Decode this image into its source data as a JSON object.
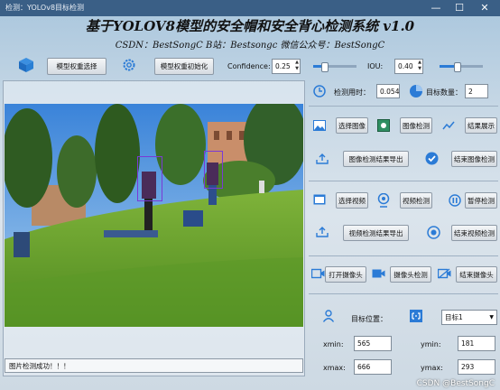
{
  "window": {
    "title": "检测：YOLOv8目标检测",
    "controls": [
      "—",
      "☐",
      "✕"
    ]
  },
  "header": {
    "title": "基于YOLOV8模型的安全帽和安全背心检测系统 v1.0",
    "subtitle": "CSDN：BestSongC   B站：Bestsongc   微信公众号：BestSongC"
  },
  "toolbar": {
    "select_weights_label": "模型权重选择",
    "init_weights_label": "模型权重初始化",
    "confidence_label": "Confidence:",
    "confidence_value": "0.25",
    "confidence_level": 0.25,
    "iou_label": "IOU:",
    "iou_value": "0.40",
    "iou_level": 0.4
  },
  "stats": {
    "time_label": "检测用时：",
    "time_value": "0.054",
    "count_label": "目标数量：",
    "count_value": "2"
  },
  "image_section": {
    "select_image": "选择图像",
    "image_detect": "图像检测",
    "show_result": "结果展示",
    "export_image": "图像检测结果导出",
    "end_image": "结束图像检测"
  },
  "video_section": {
    "select_video": "选择视频",
    "video_detect": "视频检测",
    "pause_detect": "暂停检测",
    "export_video": "视频检测结果导出",
    "end_video": "结束视频检测"
  },
  "camera_section": {
    "open_camera": "打开摄像头",
    "camera_detect": "摄像头检测",
    "close_camera": "结束摄像头"
  },
  "target": {
    "position_label": "目标位置：",
    "selected": "目标1",
    "xmin_label": "xmin:",
    "xmin": "565",
    "ymin_label": "ymin:",
    "ymin": "181",
    "xmax_label": "xmax:",
    "xmax": "666",
    "ymax_label": "ymax:",
    "ymax": "293"
  },
  "status_text": "图片检测成功！！！",
  "watermark": "CSDN @BestSongC",
  "colors": {
    "accent": "#2b7bd6",
    "titlebar": "#3a5f86",
    "detection_box": "#7a3ad6"
  },
  "icons": [
    "cube-icon",
    "gear-icon",
    "clock-icon",
    "pie-icon",
    "image-icon",
    "picture-detect-icon",
    "chart-icon",
    "export-icon",
    "check-icon",
    "video-icon",
    "webcam-icon",
    "pause-icon",
    "stop-icon",
    "camera-icon",
    "person-icon",
    "target-icon"
  ]
}
